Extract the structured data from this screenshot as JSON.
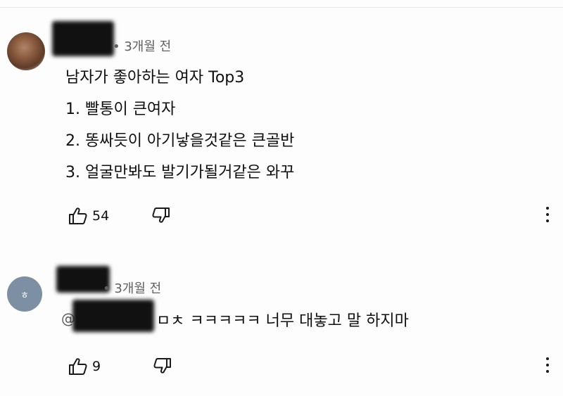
{
  "comments": [
    {
      "time": "• 3개월 전",
      "lines": [
        "남자가 좋아하는 여자 Top3",
        "1. 빨통이 큰여자",
        "2. 똥싸듯이 아기낳을것같은 큰골반",
        "3. 얼굴만봐도 발기가될거같은 와꾸"
      ],
      "likes": "54",
      "icons": {
        "like": "thumbs-up-icon",
        "dislike": "thumbs-down-icon",
        "more": "more-vert-icon"
      }
    },
    {
      "avatar_letter": "ㅎ",
      "time": "• 3개월 전",
      "mention_prefix": "@",
      "text": "ㅁㅊ ㅋㅋㅋㅋㅋ 너무 대놓고 말 하지마",
      "likes": "9",
      "icons": {
        "like": "thumbs-up-icon",
        "dislike": "thumbs-down-icon",
        "more": "more-vert-icon"
      }
    }
  ]
}
